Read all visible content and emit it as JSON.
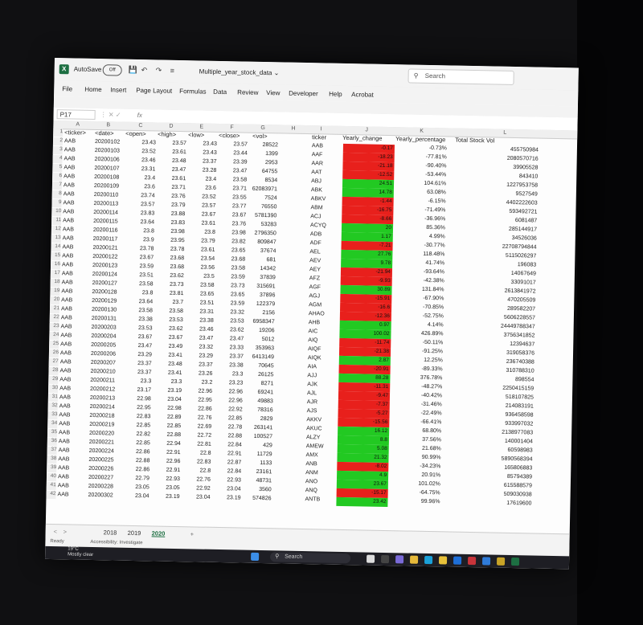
{
  "window": {
    "autosave_label": "AutoSave",
    "autosave_state": "Off",
    "doc_title": "Multiple_year_stock_data ⌄",
    "search_placeholder": "Search"
  },
  "menu": [
    "File",
    "Home",
    "Insert",
    "Page Layout",
    "Formulas",
    "Data",
    "Review",
    "View",
    "Developer",
    "Help",
    "Acrobat"
  ],
  "formula_bar": {
    "namebox": "P17",
    "fx": "fx"
  },
  "columns": [
    "A",
    "B",
    "C",
    "D",
    "E",
    "F",
    "G",
    "H",
    "I",
    "J",
    "K",
    "L"
  ],
  "headers": {
    "ticker": "<ticker>",
    "date": "<date>",
    "open": "<open>",
    "high": "<high>",
    "low": "<low>",
    "close": "<close>",
    "vol": "<vol>",
    "summary_ticker": "ticker",
    "yearly_change": "Yearly_change",
    "yearly_percentage": "Yearly_percentage",
    "total_volume": "Total Stock Vol"
  },
  "rows": [
    {
      "t": "AAB",
      "d": "20200102",
      "o": "23.43",
      "h": "23.57",
      "l": "23.43",
      "c": "23.57",
      "v": "28522"
    },
    {
      "t": "AAB",
      "d": "20200103",
      "o": "23.52",
      "h": "23.61",
      "l": "23.43",
      "c": "23.44",
      "v": "1399"
    },
    {
      "t": "AAB",
      "d": "20200106",
      "o": "23.46",
      "h": "23.48",
      "l": "23.37",
      "c": "23.39",
      "v": "2953"
    },
    {
      "t": "AAB",
      "d": "20200107",
      "o": "23.31",
      "h": "23.47",
      "l": "23.28",
      "c": "23.47",
      "v": "64755"
    },
    {
      "t": "AAB",
      "d": "20200108",
      "o": "23.4",
      "h": "23.61",
      "l": "23.4",
      "c": "23.58",
      "v": "8534"
    },
    {
      "t": "AAB",
      "d": "20200109",
      "o": "23.6",
      "h": "23.71",
      "l": "23.6",
      "c": "23.71",
      "v": "62083971"
    },
    {
      "t": "AAB",
      "d": "20200110",
      "o": "23.74",
      "h": "23.76",
      "l": "23.52",
      "c": "23.55",
      "v": "7524"
    },
    {
      "t": "AAB",
      "d": "20200113",
      "o": "23.57",
      "h": "23.79",
      "l": "23.57",
      "c": "23.77",
      "v": "76550"
    },
    {
      "t": "AAB",
      "d": "20200114",
      "o": "23.83",
      "h": "23.88",
      "l": "23.67",
      "c": "23.67",
      "v": "5781390"
    },
    {
      "t": "AAB",
      "d": "20200115",
      "o": "23.64",
      "h": "23.83",
      "l": "23.61",
      "c": "23.76",
      "v": "53283"
    },
    {
      "t": "AAB",
      "d": "20200116",
      "o": "23.8",
      "h": "23.98",
      "l": "23.8",
      "c": "23.98",
      "v": "2796350"
    },
    {
      "t": "AAB",
      "d": "20200117",
      "o": "23.9",
      "h": "23.95",
      "l": "23.79",
      "c": "23.82",
      "v": "809847"
    },
    {
      "t": "AAB",
      "d": "20200121",
      "o": "23.78",
      "h": "23.78",
      "l": "23.61",
      "c": "23.65",
      "v": "37674"
    },
    {
      "t": "AAB",
      "d": "20200122",
      "o": "23.67",
      "h": "23.68",
      "l": "23.54",
      "c": "23.68",
      "v": "681"
    },
    {
      "t": "AAB",
      "d": "20200123",
      "o": "23.59",
      "h": "23.68",
      "l": "23.56",
      "c": "23.58",
      "v": "14342"
    },
    {
      "t": "AAB",
      "d": "20200124",
      "o": "23.51",
      "h": "23.62",
      "l": "23.5",
      "c": "23.59",
      "v": "37839"
    },
    {
      "t": "AAB",
      "d": "20200127",
      "o": "23.58",
      "h": "23.73",
      "l": "23.58",
      "c": "23.73",
      "v": "315691"
    },
    {
      "t": "AAB",
      "d": "20200128",
      "o": "23.8",
      "h": "23.81",
      "l": "23.65",
      "c": "23.65",
      "v": "37896"
    },
    {
      "t": "AAB",
      "d": "20200129",
      "o": "23.64",
      "h": "23.7",
      "l": "23.51",
      "c": "23.59",
      "v": "122379"
    },
    {
      "t": "AAB",
      "d": "20200130",
      "o": "23.58",
      "h": "23.58",
      "l": "23.31",
      "c": "23.32",
      "v": "2156"
    },
    {
      "t": "AAB",
      "d": "20200131",
      "o": "23.38",
      "h": "23.53",
      "l": "23.38",
      "c": "23.53",
      "v": "6958347"
    },
    {
      "t": "AAB",
      "d": "20200203",
      "o": "23.53",
      "h": "23.62",
      "l": "23.46",
      "c": "23.62",
      "v": "19206"
    },
    {
      "t": "AAB",
      "d": "20200204",
      "o": "23.67",
      "h": "23.67",
      "l": "23.47",
      "c": "23.47",
      "v": "5012"
    },
    {
      "t": "AAB",
      "d": "20200205",
      "o": "23.47",
      "h": "23.49",
      "l": "23.32",
      "c": "23.33",
      "v": "353963"
    },
    {
      "t": "AAB",
      "d": "20200206",
      "o": "23.29",
      "h": "23.41",
      "l": "23.29",
      "c": "23.37",
      "v": "6413149"
    },
    {
      "t": "AAB",
      "d": "20200207",
      "o": "23.37",
      "h": "23.48",
      "l": "23.37",
      "c": "23.38",
      "v": "70645"
    },
    {
      "t": "AAB",
      "d": "20200210",
      "o": "23.37",
      "h": "23.41",
      "l": "23.26",
      "c": "23.3",
      "v": "26125"
    },
    {
      "t": "AAB",
      "d": "20200211",
      "o": "23.3",
      "h": "23.3",
      "l": "23.2",
      "c": "23.23",
      "v": "8271"
    },
    {
      "t": "AAB",
      "d": "20200212",
      "o": "23.17",
      "h": "23.19",
      "l": "22.96",
      "c": "22.96",
      "v": "69241"
    },
    {
      "t": "AAB",
      "d": "20200213",
      "o": "22.98",
      "h": "23.04",
      "l": "22.95",
      "c": "22.96",
      "v": "49883"
    },
    {
      "t": "AAB",
      "d": "20200214",
      "o": "22.95",
      "h": "22.98",
      "l": "22.86",
      "c": "22.92",
      "v": "78316"
    },
    {
      "t": "AAB",
      "d": "20200218",
      "o": "22.83",
      "h": "22.89",
      "l": "22.76",
      "c": "22.85",
      "v": "2829"
    },
    {
      "t": "AAB",
      "d": "20200219",
      "o": "22.85",
      "h": "22.85",
      "l": "22.69",
      "c": "22.78",
      "v": "263141"
    },
    {
      "t": "AAB",
      "d": "20200220",
      "o": "22.82",
      "h": "22.88",
      "l": "22.72",
      "c": "22.88",
      "v": "100527"
    },
    {
      "t": "AAB",
      "d": "20200221",
      "o": "22.85",
      "h": "22.94",
      "l": "22.81",
      "c": "22.84",
      "v": "429"
    },
    {
      "t": "AAB",
      "d": "20200224",
      "o": "22.86",
      "h": "22.91",
      "l": "22.8",
      "c": "22.91",
      "v": "11729"
    },
    {
      "t": "AAB",
      "d": "20200225",
      "o": "22.88",
      "h": "22.96",
      "l": "22.83",
      "c": "22.87",
      "v": "1133"
    },
    {
      "t": "AAB",
      "d": "20200226",
      "o": "22.86",
      "h": "22.91",
      "l": "22.8",
      "c": "22.84",
      "v": "23161"
    },
    {
      "t": "AAB",
      "d": "20200227",
      "o": "22.79",
      "h": "22.93",
      "l": "22.76",
      "c": "22.93",
      "v": "48731"
    },
    {
      "t": "AAB",
      "d": "20200228",
      "o": "23.05",
      "h": "23.05",
      "l": "22.92",
      "c": "23.04",
      "v": "3560"
    },
    {
      "t": "AAB",
      "d": "20200302",
      "o": "23.04",
      "h": "23.19",
      "l": "23.04",
      "c": "23.19",
      "v": "574826"
    }
  ],
  "summary": [
    {
      "tk": "AAB",
      "ch": "-0.17",
      "pct": "-0.73%",
      "vol": "455750984",
      "pos": false
    },
    {
      "tk": "AAF",
      "ch": "-18.23",
      "pct": "-77.81%",
      "vol": "2080570716",
      "pos": false
    },
    {
      "tk": "AAR",
      "ch": "-21.18",
      "pct": "-90.40%",
      "vol": "39905528",
      "pos": false
    },
    {
      "tk": "AAT",
      "ch": "-12.52",
      "pct": "-53.44%",
      "vol": "843410",
      "pos": false
    },
    {
      "tk": "ABJ",
      "ch": "24.51",
      "pct": "104.61%",
      "vol": "1227953758",
      "pos": true
    },
    {
      "tk": "ABK",
      "ch": "14.78",
      "pct": "63.08%",
      "vol": "9527549",
      "pos": true
    },
    {
      "tk": "ABKV",
      "ch": "-1.44",
      "pct": "-6.15%",
      "vol": "4402222603",
      "pos": false
    },
    {
      "tk": "ABM",
      "ch": "-16.75",
      "pct": "-71.49%",
      "vol": "593492721",
      "pos": false
    },
    {
      "tk": "ACJ",
      "ch": "-8.66",
      "pct": "-36.96%",
      "vol": "6081487",
      "pos": false
    },
    {
      "tk": "ACYQ",
      "ch": "20",
      "pct": "85.36%",
      "vol": "285144917",
      "pos": true
    },
    {
      "tk": "ADB",
      "ch": "1.17",
      "pct": "4.99%",
      "vol": "34526036",
      "pos": true
    },
    {
      "tk": "ADF",
      "ch": "-7.21",
      "pct": "-30.77%",
      "vol": "22708794844",
      "pos": false
    },
    {
      "tk": "AEL",
      "ch": "27.76",
      "pct": "118.48%",
      "vol": "5115026297",
      "pos": true
    },
    {
      "tk": "AEV",
      "ch": "9.78",
      "pct": "41.74%",
      "vol": "196083",
      "pos": true
    },
    {
      "tk": "AEY",
      "ch": "-21.94",
      "pct": "-93.64%",
      "vol": "14067649",
      "pos": false
    },
    {
      "tk": "AFZ",
      "ch": "-9.93",
      "pct": "-42.38%",
      "vol": "33091017",
      "pos": false
    },
    {
      "tk": "AGF",
      "ch": "30.89",
      "pct": "131.84%",
      "vol": "2613841972",
      "pos": true
    },
    {
      "tk": "AGJ",
      "ch": "-15.91",
      "pct": "-67.90%",
      "vol": "470205509",
      "pos": false
    },
    {
      "tk": "AGM",
      "ch": "-16.6",
      "pct": "-70.85%",
      "vol": "289582207",
      "pos": false
    },
    {
      "tk": "AHAO",
      "ch": "-12.36",
      "pct": "-52.75%",
      "vol": "5606228557",
      "pos": false
    },
    {
      "tk": "AHB",
      "ch": "0.97",
      "pct": "4.14%",
      "vol": "24449788347",
      "pos": true
    },
    {
      "tk": "AIC",
      "ch": "100.02",
      "pct": "426.89%",
      "vol": "3756341852",
      "pos": true
    },
    {
      "tk": "AIQ",
      "ch": "-11.74",
      "pct": "-50.11%",
      "vol": "12394637",
      "pos": false
    },
    {
      "tk": "AIQF",
      "ch": "-21.38",
      "pct": "-91.25%",
      "vol": "319058376",
      "pos": false
    },
    {
      "tk": "AIQK",
      "ch": "2.87",
      "pct": "12.25%",
      "vol": "236740388",
      "pos": true
    },
    {
      "tk": "AIA",
      "ch": "-20.91",
      "pct": "-89.33%",
      "vol": "310788310",
      "pos": false
    },
    {
      "tk": "AJJ",
      "ch": "88.28",
      "pct": "376.78%",
      "vol": "898554",
      "pos": true
    },
    {
      "tk": "AJK",
      "ch": "-11.31",
      "pct": "-48.27%",
      "vol": "2250415159",
      "pos": false
    },
    {
      "tk": "AJL",
      "ch": "-9.47",
      "pct": "-40.42%",
      "vol": "518107825",
      "pos": false
    },
    {
      "tk": "AJR",
      "ch": "-7.37",
      "pct": "-31.46%",
      "vol": "214083191",
      "pos": false
    },
    {
      "tk": "AJS",
      "ch": "-5.27",
      "pct": "-22.49%",
      "vol": "936458598",
      "pos": false
    },
    {
      "tk": "AKKV",
      "ch": "-15.56",
      "pct": "-66.41%",
      "vol": "933997032",
      "pos": false
    },
    {
      "tk": "AKUC",
      "ch": "16.12",
      "pct": "68.80%",
      "vol": "2138977083",
      "pos": true
    },
    {
      "tk": "ALZY",
      "ch": "8.8",
      "pct": "37.56%",
      "vol": "140001404",
      "pos": true
    },
    {
      "tk": "AMEW",
      "ch": "5.08",
      "pct": "21.68%",
      "vol": "60598983",
      "pos": true
    },
    {
      "tk": "AMX",
      "ch": "21.32",
      "pct": "90.99%",
      "vol": "5890568394",
      "pos": true
    },
    {
      "tk": "ANB",
      "ch": "-8.02",
      "pct": "-34.23%",
      "vol": "165806883",
      "pos": false
    },
    {
      "tk": "ANM",
      "ch": "4.9",
      "pct": "20.91%",
      "vol": "85794389",
      "pos": true
    },
    {
      "tk": "ANO",
      "ch": "23.67",
      "pct": "101.02%",
      "vol": "615588579",
      "pos": true
    },
    {
      "tk": "ANQ",
      "ch": "-15.17",
      "pct": "-64.75%",
      "vol": "509030938",
      "pos": false
    },
    {
      "tk": "ANTB",
      "ch": "23.42",
      "pct": "99.96%",
      "vol": "17619600",
      "pos": true
    }
  ],
  "sheets": [
    "2018",
    "2019",
    "2020"
  ],
  "active_sheet": "2020",
  "status": {
    "ready": "Ready",
    "accessibility": "Accessibility: Investigate"
  },
  "taskbar": {
    "temp": "19°C",
    "weather": "Mostly clear",
    "search": "Search"
  },
  "colors": {
    "positive": "#22c922",
    "negative": "#e8201c",
    "excel_green": "#1d6f42"
  }
}
